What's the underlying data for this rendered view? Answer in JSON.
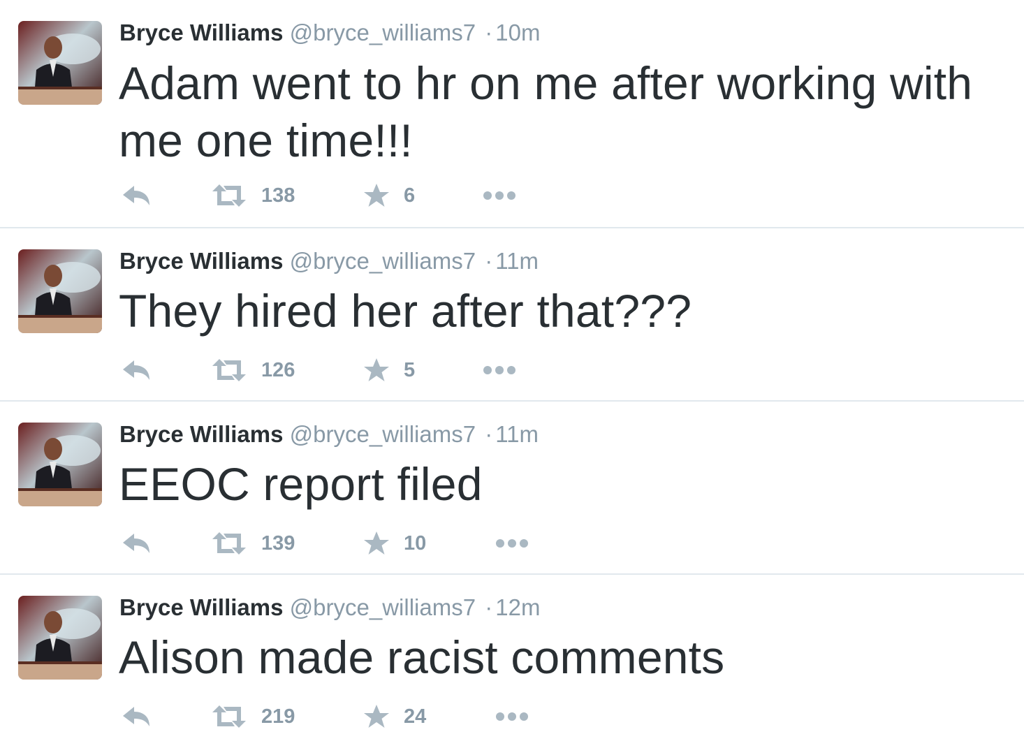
{
  "colors": {
    "text": "#292f33",
    "secondary": "#8899a6",
    "icon": "#aab8c2",
    "divider": "#e1e8ed"
  },
  "tweets": [
    {
      "name": "Bryce Williams",
      "handle": "@bryce_williams7",
      "separator": "·",
      "time": "10m",
      "text": "Adam went to hr on me after working with me one time!!!",
      "retweets": "138",
      "favorites": "6"
    },
    {
      "name": "Bryce Williams",
      "handle": "@bryce_williams7",
      "separator": "·",
      "time": "11m",
      "text": "They hired her after that???",
      "retweets": "126",
      "favorites": "5"
    },
    {
      "name": "Bryce Williams",
      "handle": "@bryce_williams7",
      "separator": "·",
      "time": "11m",
      "text": "EEOC report filed",
      "retweets": "139",
      "favorites": "10"
    },
    {
      "name": "Bryce Williams",
      "handle": "@bryce_williams7",
      "separator": "·",
      "time": "12m",
      "text": "Alison made racist comments",
      "retweets": "219",
      "favorites": "24"
    }
  ],
  "icons": {
    "reply": "reply-icon",
    "retweet": "retweet-icon",
    "favorite": "star-icon",
    "more": "more-dots-icon",
    "avatar": "avatar"
  }
}
